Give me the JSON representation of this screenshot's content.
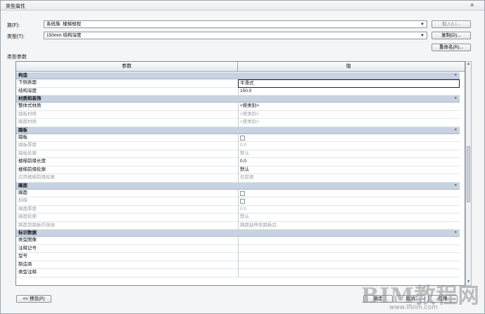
{
  "window": {
    "title": "类型属性",
    "close_glyph": "✕"
  },
  "family": {
    "label": "族(F):",
    "value": "系统族: 楼梯规程",
    "load_button": "载入(L)..."
  },
  "type": {
    "label": "类型(T):",
    "value": "150mm 结构深度",
    "duplicate_button": "复制(D)...",
    "rename_button": "重命名(R)..."
  },
  "type_params_caption": "类型参数",
  "grid": {
    "header_param": "参数",
    "header_value": "值",
    "collapse_glyph": "«",
    "groups": [
      {
        "name": "构造",
        "rows": [
          {
            "param": "下侧表面",
            "value": "平滑式",
            "editing": true
          },
          {
            "param": "结构深度",
            "value": "150.0"
          }
        ]
      },
      {
        "name": "材质和装饰",
        "rows": [
          {
            "param": "整体式材质",
            "value": "<按类别>"
          },
          {
            "param": "踏板材质",
            "value": "<按类别>",
            "dim": true
          },
          {
            "param": "踢面材质",
            "value": "<按类别>",
            "dim": true
          }
        ]
      },
      {
        "name": "踏板",
        "rows": [
          {
            "param": "踏板",
            "checkbox": true
          },
          {
            "param": "踏板厚度",
            "value": "0.0",
            "dim": true
          },
          {
            "param": "踏板轮廓",
            "value": "默认",
            "dim": true
          },
          {
            "param": "楼梯前缘长度",
            "value": "0.0"
          },
          {
            "param": "楼梯前缘轮廓",
            "value": "默认"
          },
          {
            "param": "应用楼梯前缘轮廓",
            "value": "仅前侧",
            "dim": true
          }
        ]
      },
      {
        "name": "踢面",
        "rows": [
          {
            "param": "踢面",
            "checkbox": true
          },
          {
            "param": "斜梯",
            "checkbox": true,
            "dim": true
          },
          {
            "param": "踢面厚度",
            "value": "0.0",
            "dim": true
          },
          {
            "param": "踢面轮廓",
            "value": "默认",
            "dim": true
          },
          {
            "param": "踢面到踏板的连接",
            "value": "踢面延伸至踏板后",
            "dim": true
          }
        ]
      },
      {
        "name": "标识数据",
        "rows": [
          {
            "param": "类型图像",
            "value": ""
          },
          {
            "param": "注释记号",
            "value": ""
          },
          {
            "param": "型号",
            "value": ""
          },
          {
            "param": "制造商",
            "value": ""
          },
          {
            "param": "类型注释",
            "value": ""
          }
        ]
      }
    ]
  },
  "footer": {
    "preview_button": "<< 预览(P)",
    "ok_button": "确定",
    "cancel_button": "取消",
    "apply_button": "应用"
  },
  "watermark": {
    "text": "BIM教程网",
    "url": "www.lfbim.com"
  }
}
